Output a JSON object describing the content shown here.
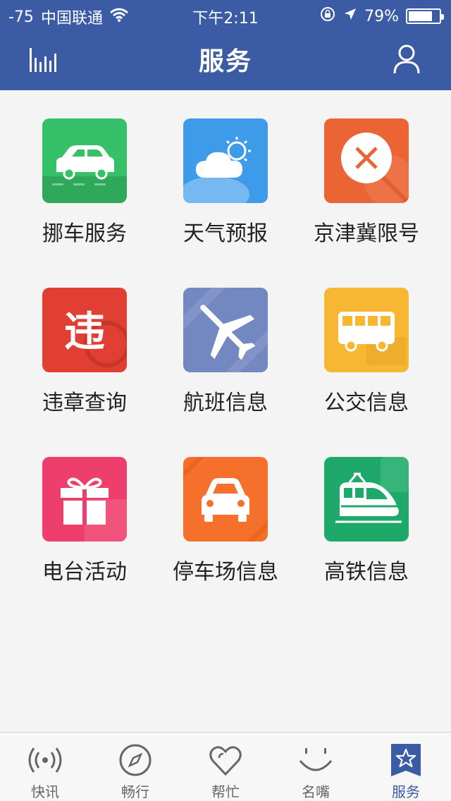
{
  "status_bar": {
    "signal": "-75",
    "carrier": "中国联通",
    "time": "下午2:11",
    "battery_percent": "79%",
    "battery_level": 0.79
  },
  "nav": {
    "title": "服务"
  },
  "services": [
    {
      "label": "挪车服务",
      "icon": "car-icon",
      "color": "#37c06a"
    },
    {
      "label": "天气预报",
      "icon": "cloud-sun-icon",
      "color": "#3d9be9"
    },
    {
      "label": "京津冀限号",
      "icon": "close-circle-icon",
      "color": "#ea6533"
    },
    {
      "label": "违章查询",
      "icon": "violation-icon",
      "glyph": "违",
      "color": "#e13f34"
    },
    {
      "label": "航班信息",
      "icon": "airplane-icon",
      "color": "#7388c1"
    },
    {
      "label": "公交信息",
      "icon": "bus-icon",
      "color": "#f7b733"
    },
    {
      "label": "电台活动",
      "icon": "gift-icon",
      "color": "#ee3f6c"
    },
    {
      "label": "停车场信息",
      "icon": "parking-car-icon",
      "color": "#f5702a"
    },
    {
      "label": "高铁信息",
      "icon": "train-icon",
      "color": "#1ea86a"
    }
  ],
  "tabs": [
    {
      "label": "快讯",
      "icon": "broadcast-icon",
      "active": false
    },
    {
      "label": "畅行",
      "icon": "compass-icon",
      "active": false
    },
    {
      "label": "帮忙",
      "icon": "heart-icon",
      "active": false
    },
    {
      "label": "名嘴",
      "icon": "smile-icon",
      "active": false
    },
    {
      "label": "服务",
      "icon": "star-badge-icon",
      "active": true
    }
  ],
  "colors": {
    "primary": "#3b5ba5",
    "background": "#f4f4f4",
    "tab_inactive": "#666666"
  }
}
